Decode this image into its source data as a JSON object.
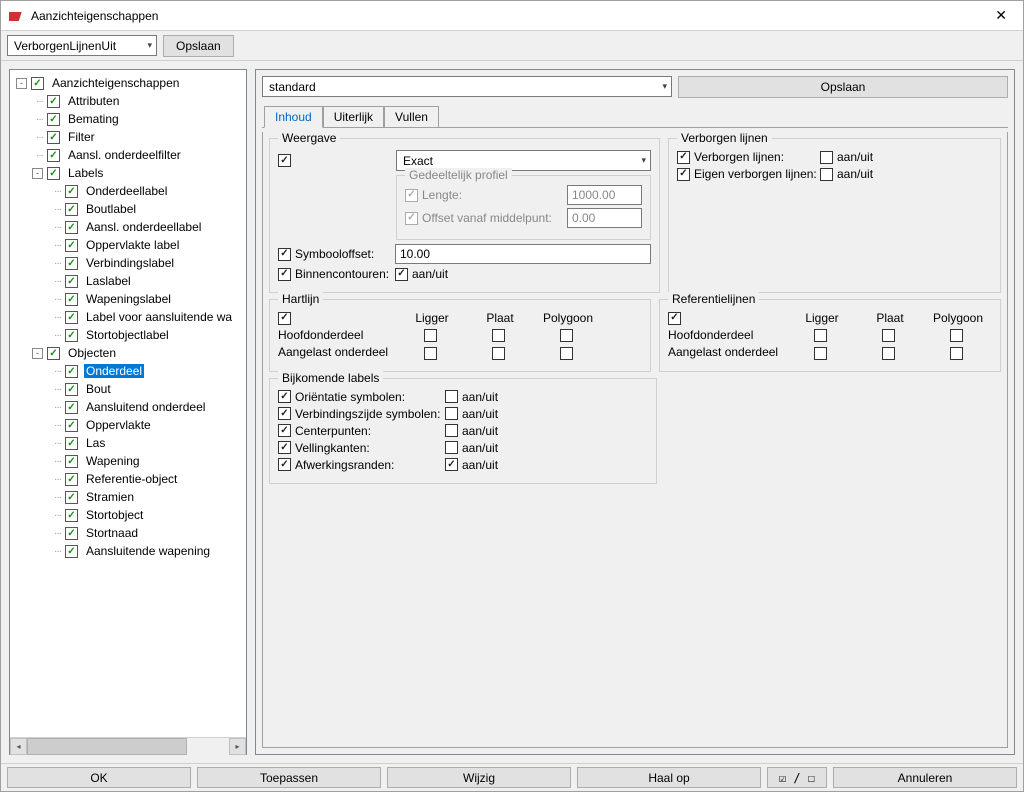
{
  "window": {
    "title": "Aanzichteigenschappen"
  },
  "topbar": {
    "combo_value": "VerborgenLijnenUit",
    "save": "Opslaan"
  },
  "tree": {
    "root": "Aanzichteigenschappen",
    "attributen": "Attributen",
    "bemating": "Bemating",
    "filter": "Filter",
    "aansl_filter": "Aansl. onderdeelfilter",
    "labels": "Labels",
    "labels_children": {
      "onderdeellabel": "Onderdeellabel",
      "boutlabel": "Boutlabel",
      "aansl_onderdeellabel": "Aansl. onderdeellabel",
      "oppervlakte_label": "Oppervlakte label",
      "verbindingslabel": "Verbindingslabel",
      "laslabel": "Laslabel",
      "wapeningslabel": "Wapeningslabel",
      "label_voor_aansluitende": "Label voor aansluitende wa",
      "stortobjectlabel": "Stortobjectlabel"
    },
    "objecten": "Objecten",
    "objecten_children": {
      "onderdeel": "Onderdeel",
      "bout": "Bout",
      "aansluitend_onderdeel": "Aansluitend onderdeel",
      "oppervlakte": "Oppervlakte",
      "las": "Las",
      "wapening": "Wapening",
      "referentie_object": "Referentie-object",
      "stramien": "Stramien",
      "stortobject": "Stortobject",
      "stortnaad": "Stortnaad",
      "aansluitende_wapening": "Aansluitende wapening"
    }
  },
  "right": {
    "combo_value": "standard",
    "save": "Opslaan",
    "tabs": {
      "inhoud": "Inhoud",
      "uiterlijk": "Uiterlijk",
      "vullen": "Vullen"
    }
  },
  "weergave": {
    "title": "Weergave",
    "combo": "Exact",
    "profiel_title": "Gedeeltelijk profiel",
    "lengte_label": "Lengte:",
    "lengte_value": "1000.00",
    "offset_label": "Offset vanaf middelpunt:",
    "offset_value": "0.00",
    "symbooloffset_label": "Symbooloffset:",
    "symbooloffset_value": "10.00",
    "binnencontouren_label": "Binnencontouren:",
    "aanuit": "aan/uit"
  },
  "verborgen": {
    "title": "Verborgen lijnen",
    "verborgen_lijnen": "Verborgen lijnen:",
    "eigen_verborgen": "Eigen verborgen lijnen:",
    "aanuit": "aan/uit"
  },
  "hartlijn": {
    "title": "Hartlijn",
    "ligger": "Ligger",
    "plaat": "Plaat",
    "polygoon": "Polygoon",
    "hoofd": "Hoofdonderdeel",
    "aangelast": "Aangelast onderdeel"
  },
  "ref": {
    "title": "Referentielijnen",
    "ligger": "Ligger",
    "plaat": "Plaat",
    "polygoon": "Polygoon",
    "hoofd": "Hoofdonderdeel",
    "aangelast": "Aangelast onderdeel"
  },
  "bijkomende": {
    "title": "Bijkomende labels",
    "orientatie": "Oriëntatie symbolen:",
    "verbindingszijde": "Verbindingszijde symbolen:",
    "centerpunten": "Centerpunten:",
    "vellingkanten": "Vellingkanten:",
    "afwerkingsranden": "Afwerkingsranden:",
    "aanuit": "aan/uit"
  },
  "bottom": {
    "ok": "OK",
    "toepassen": "Toepassen",
    "wijzig": "Wijzig",
    "haalop": "Haal op",
    "toggle": "⌐ / ⌐",
    "annuleren": "Annuleren"
  }
}
